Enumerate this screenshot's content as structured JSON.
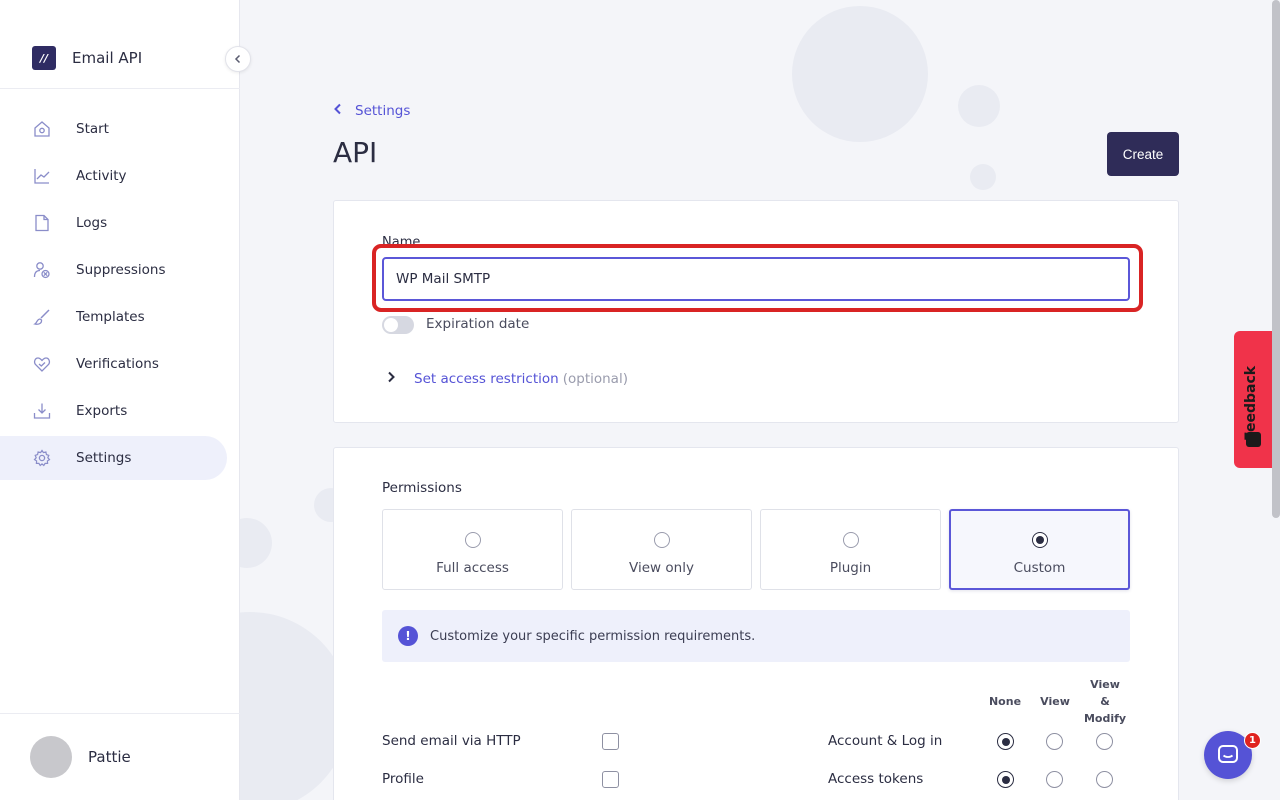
{
  "brand": {
    "name": "Email API"
  },
  "sidebar": {
    "items": [
      {
        "label": "Start",
        "icon": "home-icon",
        "active": false
      },
      {
        "label": "Activity",
        "icon": "activity-chart-icon",
        "active": false
      },
      {
        "label": "Logs",
        "icon": "document-icon",
        "active": false
      },
      {
        "label": "Suppressions",
        "icon": "user-block-icon",
        "active": false
      },
      {
        "label": "Templates",
        "icon": "brush-icon",
        "active": false
      },
      {
        "label": "Verifications",
        "icon": "heart-check-icon",
        "active": false
      },
      {
        "label": "Exports",
        "icon": "download-icon",
        "active": false
      },
      {
        "label": "Settings",
        "icon": "gear-icon",
        "active": true
      }
    ],
    "user": {
      "name": "Pattie"
    }
  },
  "header": {
    "breadcrumb": "Settings",
    "title": "API",
    "create_label": "Create"
  },
  "form": {
    "name_label": "Name",
    "name_value": "WP Mail SMTP",
    "expiration_label": "Expiration date",
    "expiration_enabled": false,
    "access_link": "Set access restriction",
    "access_optional": "(optional)"
  },
  "permissions": {
    "title": "Permissions",
    "options": [
      {
        "label": "Full access",
        "selected": false
      },
      {
        "label": "View only",
        "selected": false
      },
      {
        "label": "Plugin",
        "selected": false
      },
      {
        "label": "Custom",
        "selected": true
      }
    ],
    "info_text": "Customize your specific permission requirements.",
    "columns": {
      "none": "None",
      "view": "View",
      "view_modify_1": "View",
      "view_modify_2": "&",
      "view_modify_3": "Modify"
    },
    "left_rows": [
      {
        "label": "Send email via HTTP",
        "checked": false
      },
      {
        "label": "Profile",
        "checked": false
      }
    ],
    "right_rows": [
      {
        "label": "Account & Log in",
        "value": "none"
      },
      {
        "label": "Access tokens",
        "value": "none"
      }
    ]
  },
  "widgets": {
    "feedback_label": "Feedback",
    "chat_badge": "1"
  },
  "colors": {
    "accent": "#5553d6",
    "primary_button": "#2f2c58",
    "highlight": "#d92424",
    "feedback": "#f0334a"
  }
}
